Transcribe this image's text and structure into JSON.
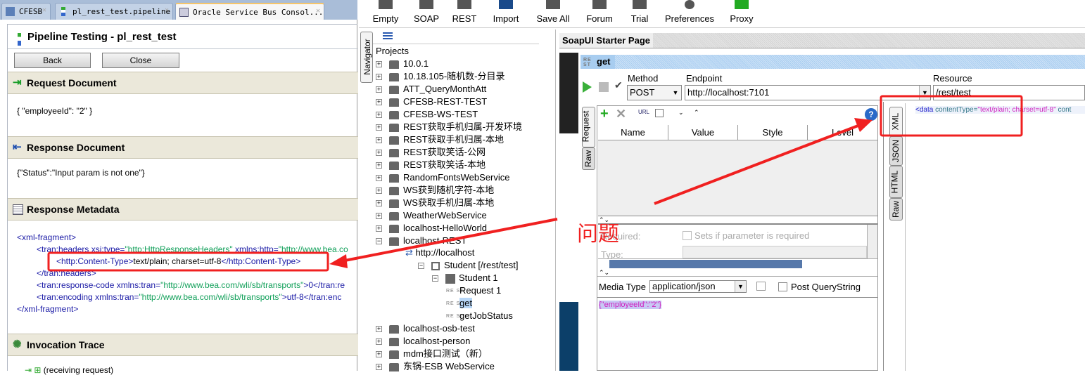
{
  "editor_tabs": [
    {
      "label": "CFESB"
    },
    {
      "label": "pl_rest_test.pipeline"
    },
    {
      "label": "Oracle Service Bus Consol..."
    }
  ],
  "pipeline": {
    "title": "Pipeline Testing - pl_rest_test",
    "back": "Back",
    "close": "Close",
    "request_doc": {
      "header": "Request Document",
      "content": "{ \"employeeId\":  \"2\" }"
    },
    "response_doc": {
      "header": "Response Document",
      "content": "{\"Status\":\"Input param is not one\"}"
    },
    "response_meta": {
      "header": "Response Metadata",
      "lines": {
        "l1": "<xml-fragment>",
        "l2a": "<tran:headers xsi:type=",
        "l2b": "\"http:HttpResponseHeaders\"",
        "l2c": " xmlns:http=",
        "l2d": "\"http://www.bea.co",
        "l3a": "<http:Content-Type>",
        "l3b": "text/plain; charset=utf-8",
        "l3c": "</http:Content-Type>",
        "l4": "</tran:headers>",
        "l5a": "<tran:response-code xmlns:tran=",
        "l5b": "\"http://www.bea.com/wli/sb/transports\"",
        "l5c": ">0</tran:re",
        "l6a": "<tran:encoding xmlns:tran=",
        "l6b": "\"http://www.bea.com/wli/sb/transports\"",
        "l6c": ">utf-8</tran:enc",
        "l7": "</xml-fragment>"
      }
    },
    "invocation": {
      "header": "Invocation Trace",
      "first": "(receiving request)"
    }
  },
  "toolbar": [
    {
      "label": "Empty"
    },
    {
      "label": "SOAP"
    },
    {
      "label": "REST"
    },
    {
      "label": "Import"
    },
    {
      "label": "Save All"
    },
    {
      "label": "Forum"
    },
    {
      "label": "Trial"
    },
    {
      "label": "Preferences"
    },
    {
      "label": "Proxy"
    }
  ],
  "navigator": {
    "tab": "Navigator",
    "root": "Projects",
    "projects": [
      "10.0.1",
      "10.18.105-随机数-分目录",
      "ATT_QueryMonthAtt",
      "CFESB-REST-TEST",
      "CFESB-WS-TEST",
      "REST获取手机归属-开发环境",
      "REST获取手机归属-本地",
      "REST获取笑话-公网",
      "REST获取笑话-本地",
      "RandomFontsWebService",
      "WS获到随机字符-本地",
      "WS获取手机归属-本地",
      "WeatherWebService",
      "localhost-HelloWorld",
      "localhost-REST"
    ],
    "expanded": {
      "service": "http://localhost",
      "resource": "Student [/rest/test]",
      "method": "Student 1",
      "requests": [
        "Request 1",
        "get",
        "getJobStatus"
      ]
    },
    "after": [
      "localhost-osb-test",
      "localhost-person",
      "mdm接口测试（新）",
      "东锅-ESB WebService"
    ]
  },
  "soapui": {
    "start_tab": "SoapUI Starter Page",
    "request_name": "get",
    "method_label": "Method",
    "method": "POST",
    "endpoint_label": "Endpoint",
    "endpoint": "http://localhost:7101",
    "resource_label": "Resource",
    "resource": "/rest/test",
    "param_cols": [
      "Name",
      "Value",
      "Style",
      "Level"
    ],
    "side_tabs": [
      "Request",
      "Raw"
    ],
    "required_label": "Required:",
    "required_check": "Sets if parameter is required",
    "type_label": "Type:",
    "media_label": "Media Type",
    "media": "application/json",
    "post_qs": "Post QueryString",
    "body": "{\"employeeId\":\"2\"}",
    "resp_tabs": [
      "XML",
      "JSON",
      "HTML",
      "Raw"
    ],
    "resp_a": "<data",
    "resp_b": " contentType=",
    "resp_c": "\"text/plain; charset=utf-8\"",
    "resp_d": " cont"
  },
  "annotation": {
    "text": "问题",
    "color": "#f02020"
  }
}
